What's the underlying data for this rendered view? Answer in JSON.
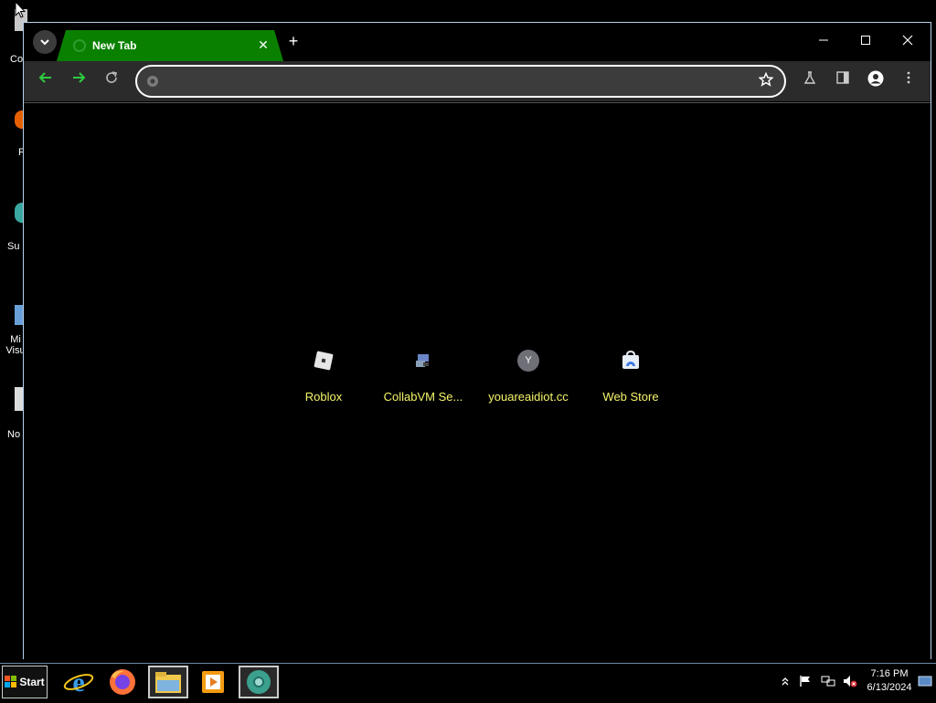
{
  "desktop": {
    "icons": [
      {
        "label": "Co"
      },
      {
        "label": "F"
      },
      {
        "label": "Su"
      },
      {
        "label": "Mi\nVisu"
      },
      {
        "label": "No"
      }
    ]
  },
  "browser": {
    "tab": {
      "title": "New Tab"
    },
    "omnibox": {
      "value": "",
      "placeholder": ""
    },
    "shortcuts": [
      {
        "label": "Roblox",
        "icon": "roblox-icon"
      },
      {
        "label": "CollabVM Se...",
        "icon": "collabvm-icon"
      },
      {
        "label": "youareaidiot.cc",
        "icon": "letter-avatar-icon",
        "letter": "Y"
      },
      {
        "label": "Web Store",
        "icon": "web-store-icon"
      }
    ],
    "colors": {
      "tab_active": "#0a8000",
      "nav_arrows": "#2ecc40",
      "shortcut_text": "#f5f56a",
      "toolbar": "#2b2b2b"
    }
  },
  "taskbar": {
    "start_label": "Start",
    "apps": [
      "internet-explorer-icon",
      "firefox-icon",
      "file-explorer-icon",
      "media-player-icon",
      "chrome-icon"
    ],
    "clock": {
      "time": "7:16 PM",
      "date": "6/13/2024"
    }
  }
}
